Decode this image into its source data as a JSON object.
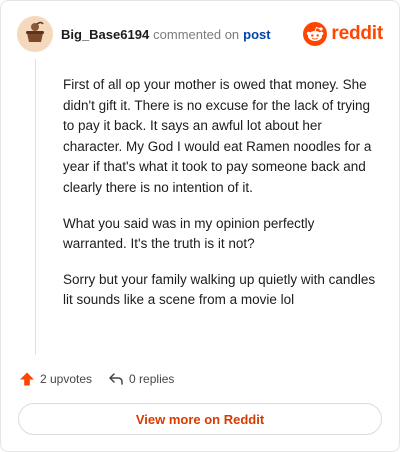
{
  "comment": {
    "username": "Big_Base6194",
    "action_text": "commented on",
    "post_link": "post",
    "paragraphs": [
      "First of all op your mother is owed that money. She didn't gift it. There is no excuse for the lack of trying to pay it back. It says an awful lot about her character. My God I would eat Ramen noodles for a year if that's what it took to pay someone back and clearly there is no intention of it.",
      "What you said was in my opinion perfectly warranted. It's the truth is it not?",
      "Sorry but your family walking up quietly with candles lit sounds like a scene from a movie lol"
    ]
  },
  "brand": {
    "wordmark": "reddit",
    "icon": "reddit-snoo-icon",
    "color": "#ff4500"
  },
  "actions": {
    "upvotes": "2 upvotes",
    "replies": "0 replies",
    "upvote_icon": "upvote-arrow-icon",
    "reply_icon": "reply-arrow-icon",
    "upvote_color": "#ff4500"
  },
  "cta": {
    "label": "View more on Reddit"
  }
}
